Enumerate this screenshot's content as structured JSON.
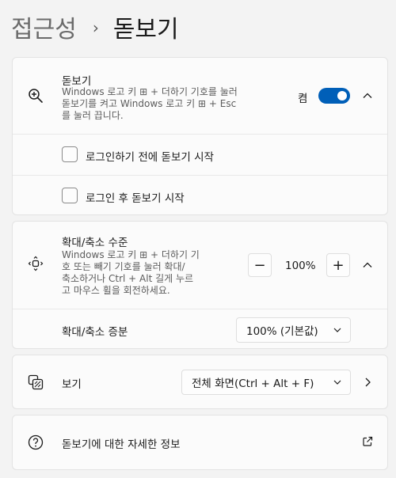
{
  "breadcrumb": {
    "parent": "접근성",
    "separator": "›",
    "current": "돋보기"
  },
  "magnifier": {
    "title": "돋보기",
    "description_lines": [
      "Windows 로고 키 ⊞ + 더하기 기호를 눌러",
      "돋보기를 켜고 Windows 로고 키 ⊞ + Esc",
      "를 눌러 끕니다."
    ],
    "toggle_label": "켬",
    "toggle_on": true,
    "icon": "magnifier-plus-icon",
    "accent_color": "#005fb8"
  },
  "options": [
    {
      "label": "로그인하기 전에 돋보기 시작",
      "checked": false
    },
    {
      "label": "로그인 후 돋보기 시작",
      "checked": false
    }
  ],
  "zoom": {
    "title": "확대/축소 수준",
    "description_lines": [
      "Windows 로고 키 ⊞ + 더하기 기",
      "호 또는 빼기 기호를 눌러 확대/",
      "축소하거나 Ctrl + Alt 길게 누르",
      "고 마우스 휠을 회전하세요."
    ],
    "minus_label": "−",
    "plus_label": "+",
    "value": "100%",
    "increment_label": "확대/축소 증분",
    "increment_value": "100% (기본값)"
  },
  "view": {
    "label": "보기",
    "value": "전체 화면(Ctrl + Alt + F)"
  },
  "help": {
    "label": "돋보기에 대한 자세한 정보"
  }
}
